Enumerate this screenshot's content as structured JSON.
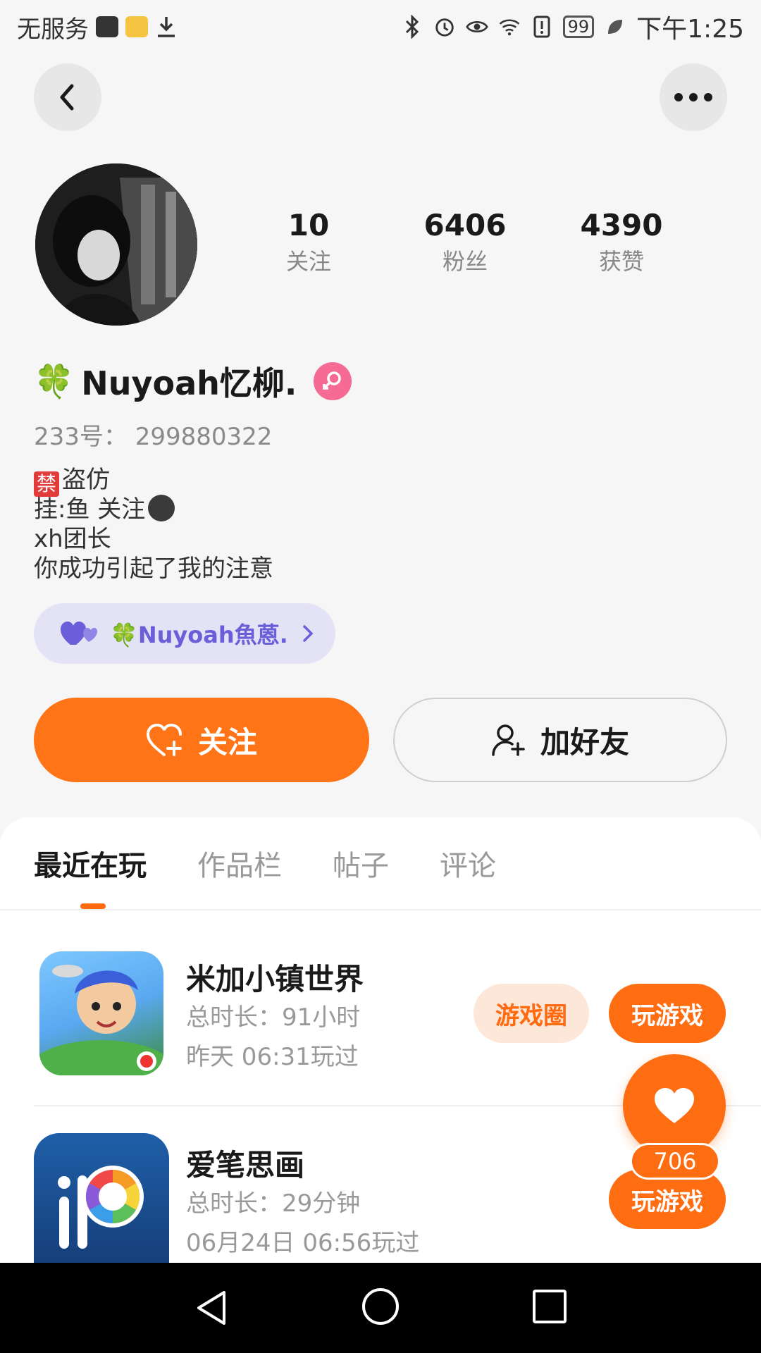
{
  "status_bar": {
    "carrier": "无服务",
    "battery": "99",
    "time": "下午1:25"
  },
  "profile": {
    "stats": [
      {
        "value": "10",
        "label": "关注"
      },
      {
        "value": "6406",
        "label": "粉丝"
      },
      {
        "value": "4390",
        "label": "获赞"
      }
    ],
    "name_emoji": "🍀",
    "name": "Nuyoah忆柳.",
    "uid": "233号： 299880322",
    "bio": {
      "line1": "盗仿",
      "line1_badge": "禁",
      "line2": "挂:鱼 关注",
      "line3": "xh团长",
      "line4": "你成功引起了我的注意"
    },
    "cp_label": "🍀Nuyoah魚蒽."
  },
  "actions": {
    "follow": "关注",
    "add_friend": "加好友"
  },
  "tabs": [
    {
      "label": "最近在玩",
      "active": true
    },
    {
      "label": "作品栏",
      "active": false
    },
    {
      "label": "帖子",
      "active": false
    },
    {
      "label": "评论",
      "active": false
    }
  ],
  "games": [
    {
      "title": "米加小镇世界",
      "duration": "总时长：91小时",
      "last_played": "昨天 06:31玩过",
      "circle_label": "游戏圈",
      "play_label": "玩游戏"
    },
    {
      "title": "爱笔思画",
      "duration": "总时长：29分钟",
      "last_played": "06月24日 06:56玩过",
      "play_label": "玩游戏"
    }
  ],
  "like_count": "706",
  "colors": {
    "accent": "#ff7416",
    "cp_text": "#6a5fd9",
    "gender_badge": "#f56b94"
  }
}
